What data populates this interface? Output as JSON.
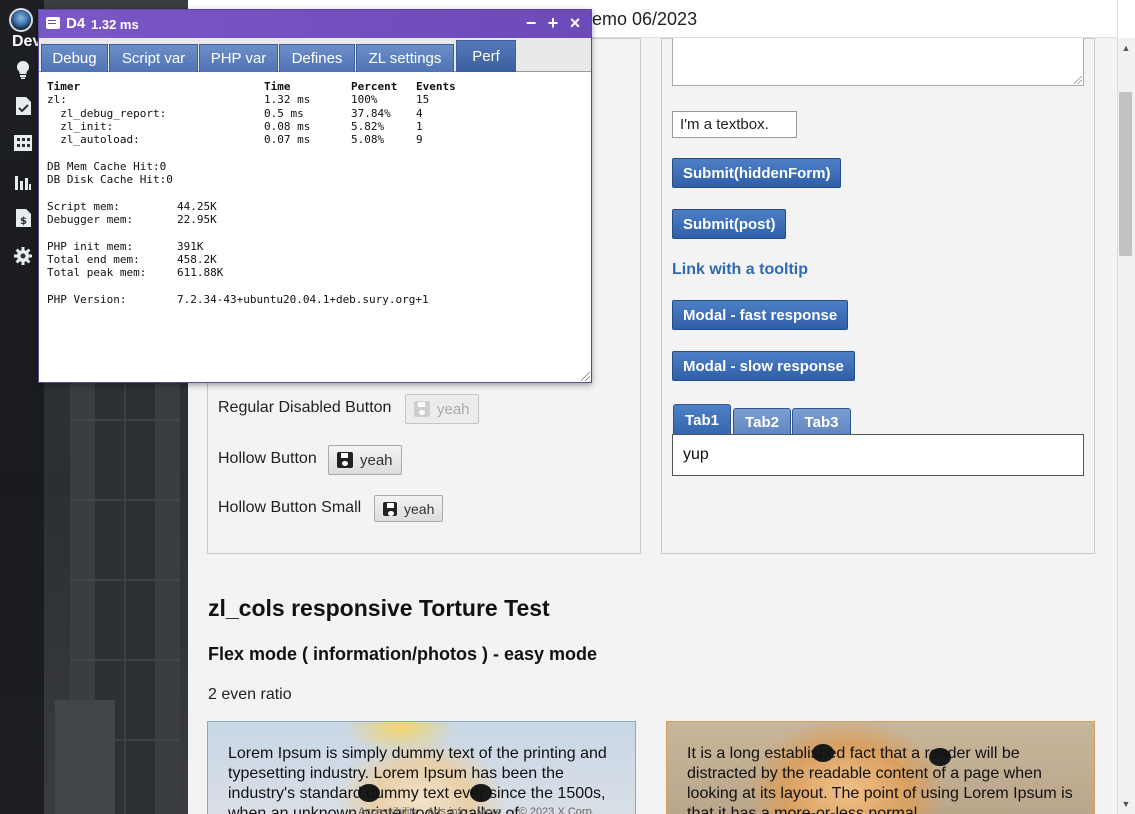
{
  "sidebar": {
    "label": "Dev"
  },
  "topbar": {
    "title": "emo 06/2023"
  },
  "right_panel": {
    "textbox_value": "I'm a textbox.",
    "submit_hidden_label": "Submit(hiddenForm)",
    "submit_post_label": "Submit(post)",
    "tooltip_link": "Link with a tooltip",
    "modal_fast_label": "Modal - fast response",
    "modal_slow_label": "Modal - slow response",
    "tabs": [
      {
        "label": "Tab1"
      },
      {
        "label": "Tab2"
      },
      {
        "label": "Tab3"
      }
    ],
    "tab_content": "yup"
  },
  "left_panel": {
    "disabled_row_label": "Regular Disabled Button",
    "hollow_row_label": "Hollow Button",
    "hollow_small_row_label": "Hollow Button Small",
    "button_label": "yeah"
  },
  "section": {
    "heading": "zl_cols responsive Torture Test",
    "subheading": "Flex mode ( information/photos ) - easy mode",
    "ratio_label": "2 even ratio",
    "card1_text": "Lorem Ipsum is simply dummy text of the printing and typesetting industry. Lorem Ipsum has been the industry's standard dummy text ever since the 1500s, when an unknown printer took a galley of",
    "card2_text": "It is a long established fact that a reader will be distracted by the readable content of a page when looking at its layout. The point of using Lorem Ipsum is that it has a more-or-less normal",
    "footer": "Accessibility · Ads info · More ··· © 2023 X Corp."
  },
  "debug": {
    "name": "D4",
    "time": "1.32 ms",
    "tabs": [
      {
        "label": "Debug"
      },
      {
        "label": "Script var"
      },
      {
        "label": "PHP var"
      },
      {
        "label": "Defines"
      },
      {
        "label": "ZL settings"
      },
      {
        "label": "Perf"
      }
    ],
    "headers": {
      "timer": "Timer",
      "time": "Time",
      "percent": "Percent",
      "events": "Events"
    },
    "timers": [
      {
        "name": "zl:",
        "time": "1.32 ms",
        "percent": "100%",
        "events": "15"
      },
      {
        "name": "  zl_debug_report:",
        "time": "0.5 ms",
        "percent": "37.84%",
        "events": "4"
      },
      {
        "name": "  zl_init:",
        "time": "0.08 ms",
        "percent": "5.82%",
        "events": "1"
      },
      {
        "name": "  zl_autoload:",
        "time": "0.07 ms",
        "percent": "5.08%",
        "events": "9"
      }
    ],
    "cache": [
      {
        "key": "DB Mem Cache Hit:",
        "value": "0"
      },
      {
        "key": "DB Disk Cache Hit:",
        "value": "0"
      }
    ],
    "mem1": [
      {
        "key": "Script mem:",
        "value": "44.25K"
      },
      {
        "key": "Debugger mem:",
        "value": "22.95K"
      }
    ],
    "mem2": [
      {
        "key": "PHP init mem:",
        "value": "391K"
      },
      {
        "key": "Total end mem:",
        "value": "458.2K"
      },
      {
        "key": "Total peak mem:",
        "value": "611.88K"
      }
    ],
    "php": {
      "key": "PHP Version:",
      "value": "7.2.34-43+ubuntu20.04.1+deb.sury.org+1"
    }
  },
  "icons": [
    "lightbulb-icon",
    "document-check-icon",
    "building-icon",
    "bar-chart-icon",
    "invoice-icon",
    "gear-icon",
    "floppy-disk-icon",
    "message-icon",
    "minimize-icon",
    "maximize-icon",
    "close-icon"
  ]
}
